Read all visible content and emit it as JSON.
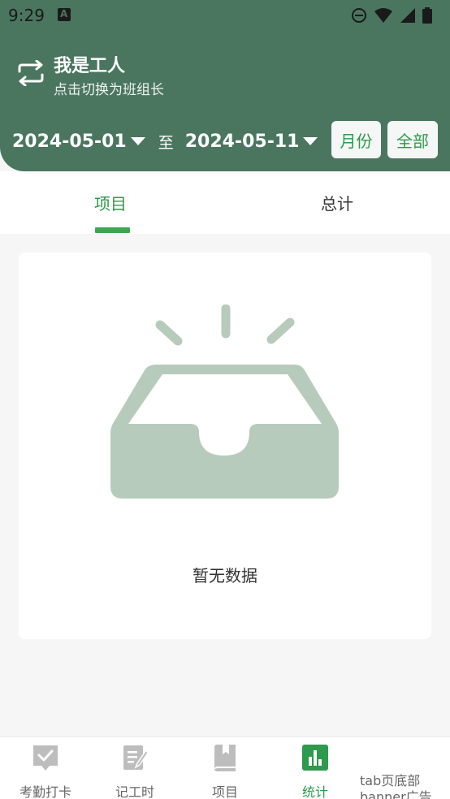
{
  "status_bar": {
    "time": "9:29",
    "icons": [
      "a-icon",
      "dnd-icon",
      "wifi-icon",
      "signal-icon",
      "battery-icon"
    ]
  },
  "header": {
    "role_title": "我是工人",
    "role_subtitle": "点击切换为班组长",
    "start_date": "2024-05-01",
    "separator": "至",
    "end_date": "2024-05-11",
    "month_button": "月份",
    "all_button": "全部",
    "switch_icon": "switch-arrows-icon",
    "background_color": "#4a7660"
  },
  "tabs": [
    {
      "label": "项目",
      "active": true
    },
    {
      "label": "总计",
      "active": false
    }
  ],
  "empty_state": {
    "icon": "empty-inbox-icon",
    "message": "暂无数据"
  },
  "bottom_nav": [
    {
      "label": "考勤打卡",
      "icon": "checkin-icon",
      "active": false
    },
    {
      "label": "记工时",
      "icon": "edit-note-icon",
      "active": false
    },
    {
      "label": "项目",
      "icon": "book-icon",
      "active": false
    },
    {
      "label": "统计",
      "icon": "bar-chart-icon",
      "active": true
    }
  ],
  "bottom_ad": {
    "line1": "tab页底部",
    "line2": "banner广告"
  },
  "colors": {
    "accent": "#2d9a4c",
    "header": "#4a7660",
    "empty_icon": "#b7cbbd",
    "inactive_icon": "#bdbdbd"
  }
}
